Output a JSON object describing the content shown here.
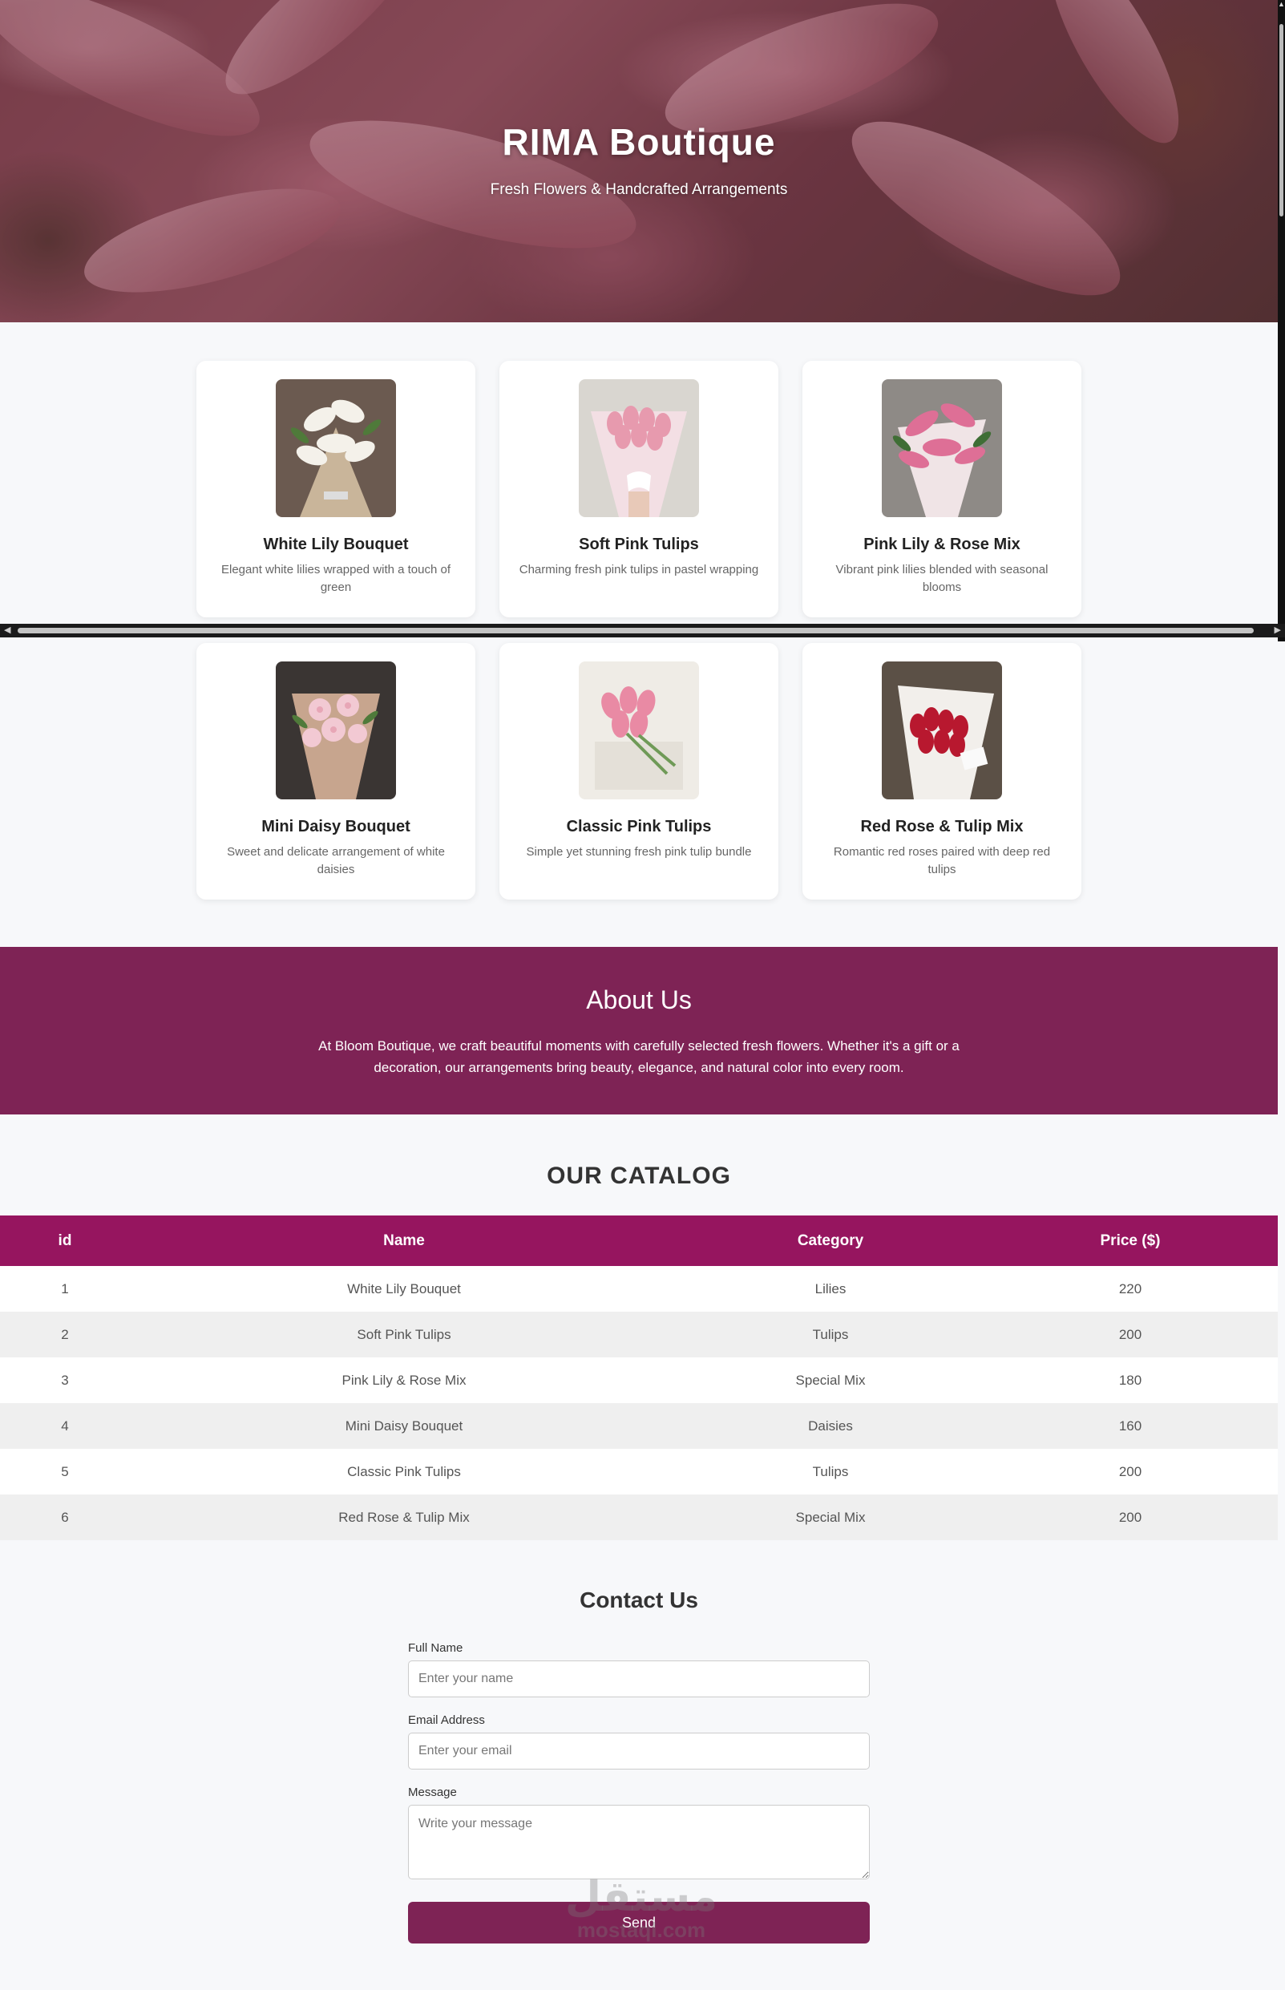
{
  "hero": {
    "title": "RIMA Boutique",
    "subtitle": "Fresh Flowers & Handcrafted Arrangements"
  },
  "products": [
    {
      "name": "White Lily Bouquet",
      "desc": "Elegant white lilies wrapped with a touch of green",
      "image": "white-lily-bouquet-photo"
    },
    {
      "name": "Soft Pink Tulips",
      "desc": "Charming fresh pink tulips in pastel wrapping",
      "image": "pink-tulips-photo"
    },
    {
      "name": "Pink Lily & Rose Mix",
      "desc": "Vibrant pink lilies blended with seasonal blooms",
      "image": "pink-lily-rose-photo"
    },
    {
      "name": "Mini Daisy Bouquet",
      "desc": "Sweet and delicate arrangement of white daisies",
      "image": "daisy-bouquet-photo"
    },
    {
      "name": "Classic Pink Tulips",
      "desc": "Simple yet stunning fresh pink tulip bundle",
      "image": "classic-tulips-photo"
    },
    {
      "name": "Red Rose & Tulip Mix",
      "desc": "Romantic red roses paired with deep red tulips",
      "image": "red-rose-tulip-photo"
    }
  ],
  "about": {
    "title": "About Us",
    "text": "At Bloom Boutique, we craft beautiful moments with carefully selected fresh flowers. Whether it's a gift or a decoration, our arrangements bring beauty, elegance, and natural color into every room."
  },
  "catalog": {
    "title": "OUR CATALOG",
    "headers": [
      "id",
      "Name",
      "Category",
      "Price ($)"
    ],
    "rows": [
      [
        "1",
        "White Lily Bouquet",
        "Lilies",
        "220"
      ],
      [
        "2",
        "Soft Pink Tulips",
        "Tulips",
        "200"
      ],
      [
        "3",
        "Pink Lily & Rose Mix",
        "Special Mix",
        "180"
      ],
      [
        "4",
        "Mini Daisy Bouquet",
        "Daisies",
        "160"
      ],
      [
        "5",
        "Classic Pink Tulips",
        "Tulips",
        "200"
      ],
      [
        "6",
        "Red Rose & Tulip Mix",
        "Special Mix",
        "200"
      ]
    ]
  },
  "contact": {
    "title": "Contact Us",
    "name_label": "Full Name",
    "name_placeholder": "Enter your name",
    "email_label": "Email Address",
    "email_placeholder": "Enter your email",
    "message_label": "Message",
    "message_placeholder": "Write your message",
    "send_label": "Send"
  },
  "watermark": {
    "line1": "مستقل",
    "line2": "mostaql.com"
  },
  "colors": {
    "accent": "#7e2355",
    "table_header": "#96155f"
  }
}
